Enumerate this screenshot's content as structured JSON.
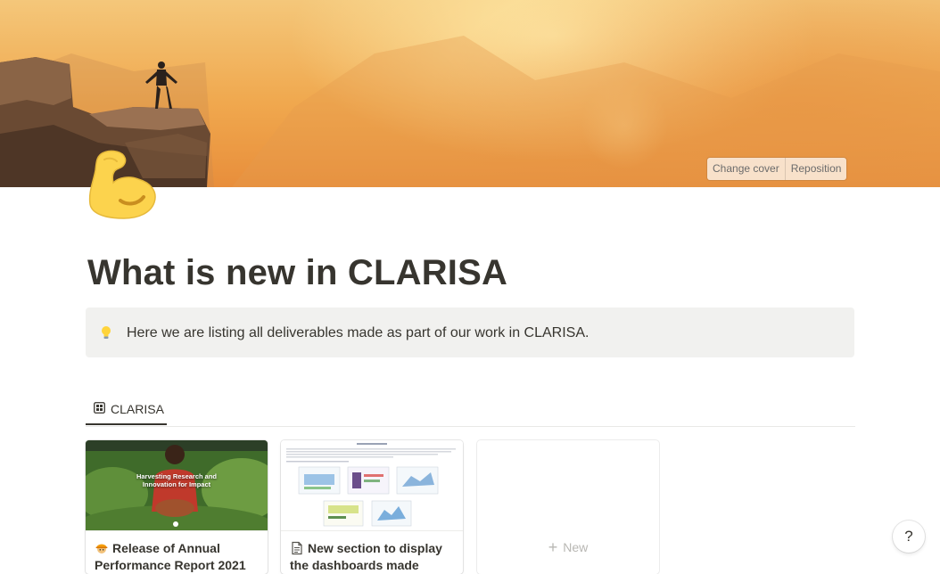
{
  "cover": {
    "actions": [
      "Change cover",
      "Reposition"
    ]
  },
  "page": {
    "icon": "flexed-biceps-icon",
    "title": "What is new in CLARISA"
  },
  "callout": {
    "icon": "light-bulb-icon",
    "text": "Here we are listing all deliverables made as part of our work in CLARISA."
  },
  "view_tabs": [
    {
      "label": "CLARISA",
      "icon": "gallery-view-icon"
    }
  ],
  "gallery": {
    "cards": [
      {
        "icon": "construction-worker-icon",
        "title": "Release of Annual Performance Report 2021",
        "thumbnail_text": "Harvesting Research and Innovation for Impact"
      },
      {
        "icon": "page-icon",
        "title": "New section to display the dashboards made"
      }
    ],
    "new_label": "New"
  },
  "help": {
    "label": "?"
  },
  "colors": {
    "text": "#37352f",
    "callout_bg": "#f1f1ef",
    "muted": "#b8b7b3"
  }
}
